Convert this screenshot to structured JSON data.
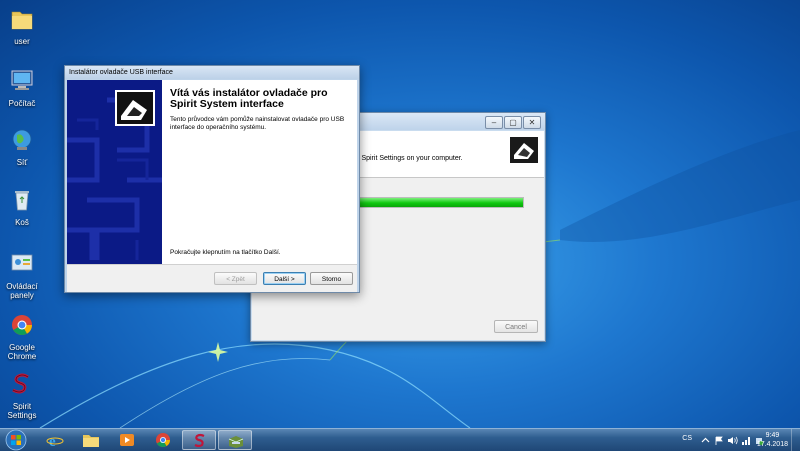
{
  "desktop": {
    "icons": [
      {
        "label": "user"
      },
      {
        "label": "Počítač"
      },
      {
        "label": "Síť"
      },
      {
        "label": "Koš"
      },
      {
        "label": "Ovládací panely"
      },
      {
        "label": "Google Chrome"
      },
      {
        "label": "Spirit Settings"
      }
    ]
  },
  "background_window": {
    "header_text": "s Spirit Settings on your computer.",
    "progress_fraction": 1.0,
    "cancel_label": "Cancel",
    "controls": [
      "–",
      "▢",
      "✕"
    ]
  },
  "installer_window": {
    "title": "Instalátor ovladače USB interface",
    "heading_line1": "Vítá vás instalátor ovladače pro",
    "heading_line2": "Spirit System interface",
    "intro": "Tento průvodce vám pomůže nainstalovat ovladače pro USB interface do operačního systému.",
    "continue_text": "Pokračujte klepnutím na tlačítko Další.",
    "buttons": {
      "back": "< Zpět",
      "next": "Další >",
      "cancel": "Storno"
    }
  },
  "taskbar": {
    "language": "CS",
    "time": "9:49",
    "date": "17.4.2018",
    "apps": [
      "internet-explorer",
      "file-explorer",
      "media-player",
      "chrome",
      "spirit-settings",
      "installer"
    ]
  },
  "colors": {
    "installer_sidebar": "#0b1a86",
    "progress_green": "#11c811",
    "desktop_blue": "#1e77cf"
  }
}
